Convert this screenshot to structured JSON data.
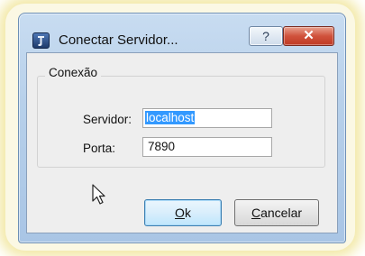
{
  "window": {
    "title": "Conectar Servidor...",
    "help_label": "?",
    "close_label": "✕"
  },
  "group": {
    "label": "Conexão"
  },
  "fields": {
    "server_label": "Servidor:",
    "server_value": "localhost",
    "port_label": "Porta:",
    "port_value": "7890"
  },
  "buttons": {
    "ok_mnemonic": "O",
    "ok_rest": "k",
    "cancel_mnemonic": "C",
    "cancel_rest": "ancelar"
  },
  "colors": {
    "selection": "#3399ff",
    "close_button": "#c94a33"
  },
  "icons": {
    "app": "app-logo-icon",
    "cursor": "mouse-pointer-icon"
  }
}
